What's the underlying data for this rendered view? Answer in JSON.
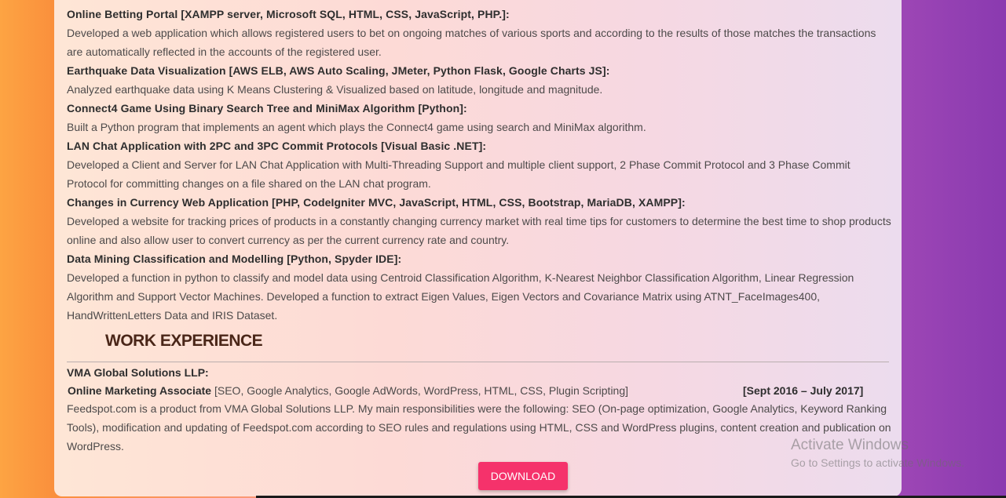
{
  "projects": [
    {
      "title": "Online Betting Portal [XAMPP server, Microsoft SQL, HTML, CSS, JavaScript, PHP.]:",
      "description": "Developed a web application which allows registered users to bet on ongoing matches of various sports and according to the results of those matches the transactions are automatically reflected in the accounts of the registered user."
    },
    {
      "title": "Earthquake Data Visualization [AWS ELB, AWS Auto Scaling, JMeter, Python Flask, Google Charts JS]:",
      "description": "Analyzed earthquake data using K Means Clustering & Visualized based on latitude, longitude and magnitude."
    },
    {
      "title": "Connect4 Game Using Binary Search Tree and MiniMax Algorithm [Python]:",
      "description": "Built a Python program that implements an agent which plays the Connect4 game using search and MiniMax algorithm."
    },
    {
      "title": "LAN Chat Application with 2PC and 3PC Commit Protocols [Visual Basic .NET]:",
      "description": "Developed a Client and Server for LAN Chat Application with Multi-Threading Support and multiple client support, 2 Phase Commit Protocol and 3 Phase Commit Protocol for committing changes on a file shared on the LAN chat program."
    },
    {
      "title": "Changes in Currency Web Application [PHP, CodeIgniter MVC, JavaScript, HTML, CSS, Bootstrap, MariaDB, XAMPP]:",
      "description": "Developed a website for tracking prices of products in a constantly changing currency market with real time tips for customers to determine the best time to shop products online and also allow user to convert currency as per the current currency rate and country."
    },
    {
      "title": "Data Mining Classification and Modelling [Python, Spyder IDE]:",
      "description": "Developed a function in python to classify and model data using Centroid Classification Algorithm, K-Nearest Neighbor Classification Algorithm, Linear Regression Algorithm and Support Vector Machines. Developed a function to extract Eigen Values, Eigen Vectors and Covariance Matrix using ATNT_FaceImages400, HandWrittenLetters Data and IRIS Dataset."
    }
  ],
  "work_experience": {
    "heading": "WORK EXPERIENCE",
    "company": "VMA Global Solutions LLP:",
    "role": "Online Marketing Associate",
    "skills": " [SEO, Google Analytics, Google AdWords, WordPress, HTML, CSS, Plugin Scripting]",
    "dates": "[Sept 2016 – July 2017]",
    "description": "Feedspot.com is a product from VMA Global Solutions LLP. My main responsibilities were the following: SEO (On-page optimization, Google Analytics, Keyword Ranking Tools), modification and updating of Feedspot.com according to SEO rules and regulations using HTML, CSS and WordPress plugins, content creation and publication on WordPress."
  },
  "download_button": {
    "label": "DOWNLOAD"
  },
  "watermark": {
    "title": "Activate Windows",
    "subtitle": "Go to Settings to activate Windows."
  }
}
